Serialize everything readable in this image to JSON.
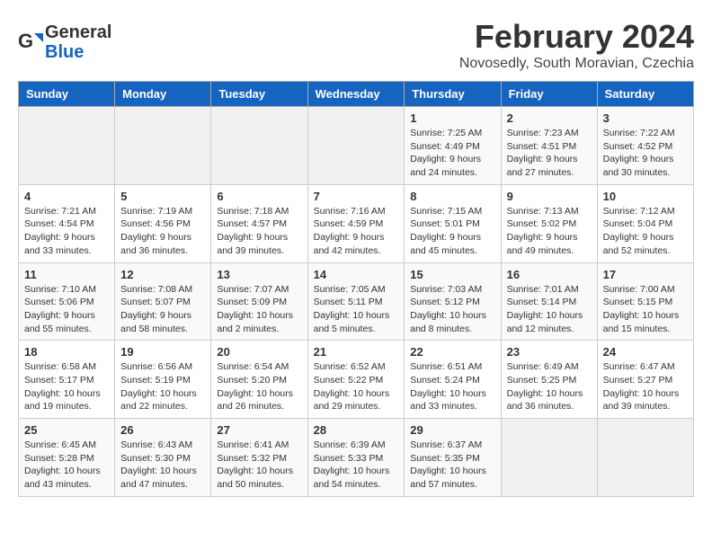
{
  "header": {
    "logo_line1": "General",
    "logo_line2": "Blue",
    "month_title": "February 2024",
    "location": "Novosedly, South Moravian, Czechia"
  },
  "weekdays": [
    "Sunday",
    "Monday",
    "Tuesday",
    "Wednesday",
    "Thursday",
    "Friday",
    "Saturday"
  ],
  "weeks": [
    [
      {
        "day": "",
        "info": ""
      },
      {
        "day": "",
        "info": ""
      },
      {
        "day": "",
        "info": ""
      },
      {
        "day": "",
        "info": ""
      },
      {
        "day": "1",
        "info": "Sunrise: 7:25 AM\nSunset: 4:49 PM\nDaylight: 9 hours\nand 24 minutes."
      },
      {
        "day": "2",
        "info": "Sunrise: 7:23 AM\nSunset: 4:51 PM\nDaylight: 9 hours\nand 27 minutes."
      },
      {
        "day": "3",
        "info": "Sunrise: 7:22 AM\nSunset: 4:52 PM\nDaylight: 9 hours\nand 30 minutes."
      }
    ],
    [
      {
        "day": "4",
        "info": "Sunrise: 7:21 AM\nSunset: 4:54 PM\nDaylight: 9 hours\nand 33 minutes."
      },
      {
        "day": "5",
        "info": "Sunrise: 7:19 AM\nSunset: 4:56 PM\nDaylight: 9 hours\nand 36 minutes."
      },
      {
        "day": "6",
        "info": "Sunrise: 7:18 AM\nSunset: 4:57 PM\nDaylight: 9 hours\nand 39 minutes."
      },
      {
        "day": "7",
        "info": "Sunrise: 7:16 AM\nSunset: 4:59 PM\nDaylight: 9 hours\nand 42 minutes."
      },
      {
        "day": "8",
        "info": "Sunrise: 7:15 AM\nSunset: 5:01 PM\nDaylight: 9 hours\nand 45 minutes."
      },
      {
        "day": "9",
        "info": "Sunrise: 7:13 AM\nSunset: 5:02 PM\nDaylight: 9 hours\nand 49 minutes."
      },
      {
        "day": "10",
        "info": "Sunrise: 7:12 AM\nSunset: 5:04 PM\nDaylight: 9 hours\nand 52 minutes."
      }
    ],
    [
      {
        "day": "11",
        "info": "Sunrise: 7:10 AM\nSunset: 5:06 PM\nDaylight: 9 hours\nand 55 minutes."
      },
      {
        "day": "12",
        "info": "Sunrise: 7:08 AM\nSunset: 5:07 PM\nDaylight: 9 hours\nand 58 minutes."
      },
      {
        "day": "13",
        "info": "Sunrise: 7:07 AM\nSunset: 5:09 PM\nDaylight: 10 hours\nand 2 minutes."
      },
      {
        "day": "14",
        "info": "Sunrise: 7:05 AM\nSunset: 5:11 PM\nDaylight: 10 hours\nand 5 minutes."
      },
      {
        "day": "15",
        "info": "Sunrise: 7:03 AM\nSunset: 5:12 PM\nDaylight: 10 hours\nand 8 minutes."
      },
      {
        "day": "16",
        "info": "Sunrise: 7:01 AM\nSunset: 5:14 PM\nDaylight: 10 hours\nand 12 minutes."
      },
      {
        "day": "17",
        "info": "Sunrise: 7:00 AM\nSunset: 5:15 PM\nDaylight: 10 hours\nand 15 minutes."
      }
    ],
    [
      {
        "day": "18",
        "info": "Sunrise: 6:58 AM\nSunset: 5:17 PM\nDaylight: 10 hours\nand 19 minutes."
      },
      {
        "day": "19",
        "info": "Sunrise: 6:56 AM\nSunset: 5:19 PM\nDaylight: 10 hours\nand 22 minutes."
      },
      {
        "day": "20",
        "info": "Sunrise: 6:54 AM\nSunset: 5:20 PM\nDaylight: 10 hours\nand 26 minutes."
      },
      {
        "day": "21",
        "info": "Sunrise: 6:52 AM\nSunset: 5:22 PM\nDaylight: 10 hours\nand 29 minutes."
      },
      {
        "day": "22",
        "info": "Sunrise: 6:51 AM\nSunset: 5:24 PM\nDaylight: 10 hours\nand 33 minutes."
      },
      {
        "day": "23",
        "info": "Sunrise: 6:49 AM\nSunset: 5:25 PM\nDaylight: 10 hours\nand 36 minutes."
      },
      {
        "day": "24",
        "info": "Sunrise: 6:47 AM\nSunset: 5:27 PM\nDaylight: 10 hours\nand 39 minutes."
      }
    ],
    [
      {
        "day": "25",
        "info": "Sunrise: 6:45 AM\nSunset: 5:28 PM\nDaylight: 10 hours\nand 43 minutes."
      },
      {
        "day": "26",
        "info": "Sunrise: 6:43 AM\nSunset: 5:30 PM\nDaylight: 10 hours\nand 47 minutes."
      },
      {
        "day": "27",
        "info": "Sunrise: 6:41 AM\nSunset: 5:32 PM\nDaylight: 10 hours\nand 50 minutes."
      },
      {
        "day": "28",
        "info": "Sunrise: 6:39 AM\nSunset: 5:33 PM\nDaylight: 10 hours\nand 54 minutes."
      },
      {
        "day": "29",
        "info": "Sunrise: 6:37 AM\nSunset: 5:35 PM\nDaylight: 10 hours\nand 57 minutes."
      },
      {
        "day": "",
        "info": ""
      },
      {
        "day": "",
        "info": ""
      }
    ]
  ]
}
